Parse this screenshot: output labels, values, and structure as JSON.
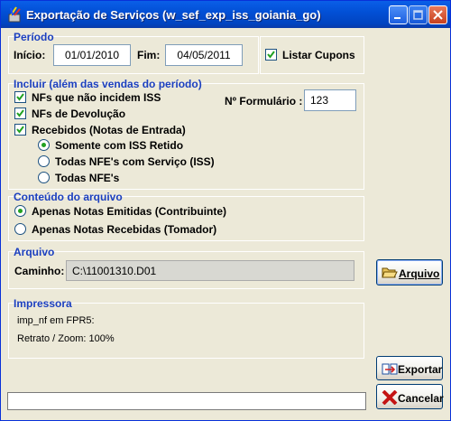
{
  "window": {
    "title": "Exportação de Serviços (w_sef_exp_iss_goiania_go)",
    "icon": "pen-cup-icon",
    "controls": [
      "minimize-icon",
      "maximize-icon",
      "close-icon"
    ]
  },
  "periodo": {
    "label": "Período",
    "inicio_label": "Início:",
    "inicio_value": "01/01/2010",
    "fim_label": "Fim:",
    "fim_value": "04/05/2011",
    "listar_cupons_label": "Listar Cupons",
    "listar_cupons_checked": true
  },
  "incluir": {
    "label": "Incluir (além das vendas do período)",
    "items": [
      {
        "label": "NFs que não incidem ISS",
        "checked": true
      },
      {
        "label": "NFs de Devolução",
        "checked": true
      },
      {
        "label": "Recebidos (Notas de Entrada)",
        "checked": true
      }
    ],
    "recebidos_options": [
      {
        "label": "Somente com ISS Retido",
        "selected": true
      },
      {
        "label": "Todas NFE's com Serviço (ISS)",
        "selected": false
      },
      {
        "label": "Todas NFE's",
        "selected": false
      }
    ],
    "formulario_label": "Nº Formulário :",
    "formulario_value": "123"
  },
  "conteudo": {
    "label": "Conteúdo do arquivo",
    "options": [
      {
        "label": "Apenas Notas Emitidas (Contribuinte)",
        "selected": true
      },
      {
        "label": "Apenas Notas Recebidas (Tomador)",
        "selected": false
      }
    ]
  },
  "arquivo": {
    "label": "Arquivo",
    "caminho_label": "Caminho:",
    "caminho_value": "C:\\11001310.D01",
    "button_label": "Arquivo",
    "button_icon": "open-folder-icon"
  },
  "impressora": {
    "label": "Impressora",
    "line1": "imp_nf em FPR5:",
    "line2": "Retrato / Zoom: 100%"
  },
  "actions": {
    "exportar_label": "Exportar",
    "exportar_icon": "export-icon",
    "cancelar_label": "Cancelar",
    "cancelar_icon": "red-x-icon"
  },
  "colors": {
    "group_label": "#1b3fbf",
    "titlebar": "#0250d6",
    "window_bg": "#ece9d8",
    "checkmark": "#21a121"
  }
}
